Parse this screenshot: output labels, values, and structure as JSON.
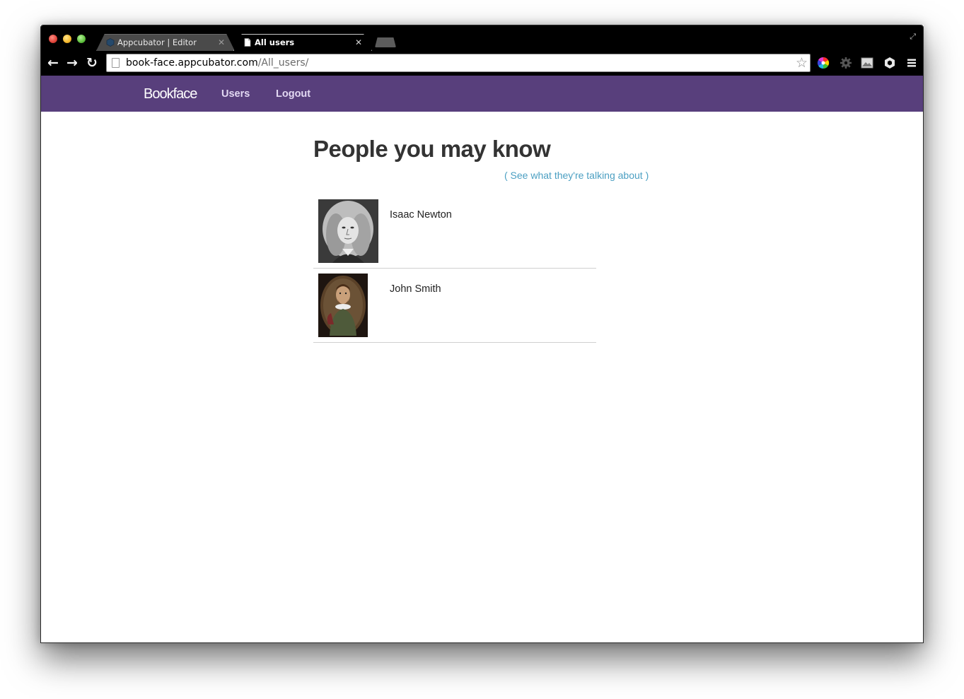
{
  "browser": {
    "tabs": [
      {
        "title": "Appcubator | Editor",
        "active": false,
        "icon": "appcubator-favicon-icon"
      },
      {
        "title": "All users",
        "active": true,
        "icon": "page-icon"
      }
    ],
    "url_host": "book-face.appcubator.com",
    "url_path": "/All_users/",
    "extension_icons": [
      "color-wheel-icon",
      "gear-icon",
      "image-icon",
      "hexagon-icon",
      "menu-icon"
    ]
  },
  "app": {
    "brand": "Bookface",
    "nav": {
      "users": "Users",
      "logout": "Logout"
    },
    "colors": {
      "navbar": "#583f7c",
      "link": "#4b9fc2"
    }
  },
  "main": {
    "heading": "People you may know",
    "talk_link": "( See what they're talking about )",
    "users": [
      {
        "name": "Isaac Newton",
        "photo": "newton-portrait"
      },
      {
        "name": "John Smith",
        "photo": "smith-portrait"
      }
    ]
  }
}
